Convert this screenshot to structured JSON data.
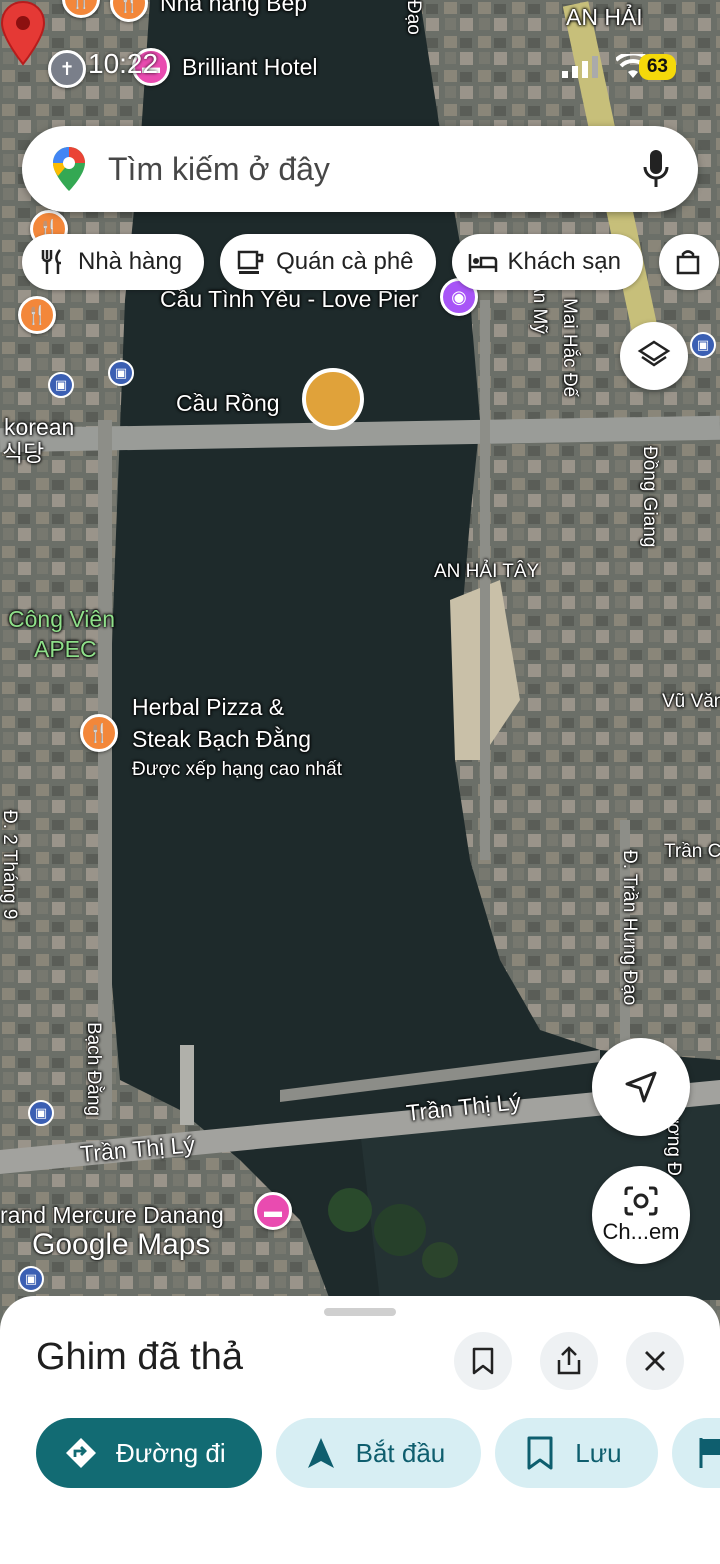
{
  "status_bar": {
    "time": "10:22",
    "battery": "63"
  },
  "search": {
    "placeholder": "Tìm kiếm ở đây"
  },
  "chips": [
    {
      "label": "Nhà hàng",
      "icon": "fork-knife-icon"
    },
    {
      "label": "Quán cà phê",
      "icon": "coffee-cup-icon"
    },
    {
      "label": "Khách sạn",
      "icon": "bed-icon"
    }
  ],
  "map": {
    "labels": {
      "nha_hang_bep": "Nhà hàng Bếp",
      "an_hai": "AN HẢI",
      "brilliant_hotel": "Brilliant Hotel",
      "love_pier": "Cầu Tình Yêu - Love Pier",
      "cau_rong": "Cầu Rồng",
      "korean": "korean",
      "korean_hangul": "식당",
      "cong_vien_apec_1": "Công Viên",
      "cong_vien_apec_2": "APEC",
      "an_hai_tay": "AN HẢI TÂY",
      "herbal_pizza_1": "Herbal Pizza &",
      "herbal_pizza_2": "Steak Bạch Đằng",
      "herbal_pizza_rating": "Được xếp hạng cao nhất",
      "vu_van": "Vũ Văn",
      "tran_c": "Trần C",
      "tran_hung_dao": "Đ. Trần Hưng Đạo",
      "dong_giang": "Đồng Giang",
      "mai_hac_de": "Mai Hắc Đế",
      "bach_dang": "Bạch Đằng",
      "tran_thi_ly_1": "Trần Thị Lý",
      "tran_thi_ly_2": "Trần Thị Lý",
      "grand_mercure": "rand Mercure Danang",
      "dao": "Đạo",
      "thang_9": "Đ. 2 Tháng 9",
      "chuong_d": "hương Đ.",
      "an_my": "An Mỹ"
    },
    "watermark": "Google Maps"
  },
  "fabs": {
    "lens_label": "Ch...em"
  },
  "sheet": {
    "title": "Ghim đã thả",
    "actions": [
      {
        "label": "Đường đi",
        "icon": "directions-icon"
      },
      {
        "label": "Bắt đầu",
        "icon": "navigation-arrow-icon"
      },
      {
        "label": "Lưu",
        "icon": "bookmark-icon"
      }
    ]
  }
}
